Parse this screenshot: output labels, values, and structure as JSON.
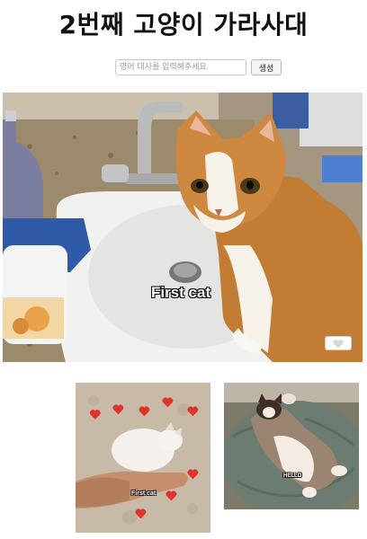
{
  "page": {
    "title": "2번째 고양이 가라사대"
  },
  "form": {
    "placeholder": "영어 대사를 입력해주세요",
    "value": "",
    "submit_label": "생성"
  },
  "main_card": {
    "caption": "First cat"
  },
  "gallery": [
    {
      "caption": "First cat"
    },
    {
      "caption": "HELLO"
    }
  ],
  "colors": {
    "like_heart": "#d9d9d9",
    "heart_sticker": "#e0332b"
  },
  "icons": {
    "like": "heart-icon"
  }
}
